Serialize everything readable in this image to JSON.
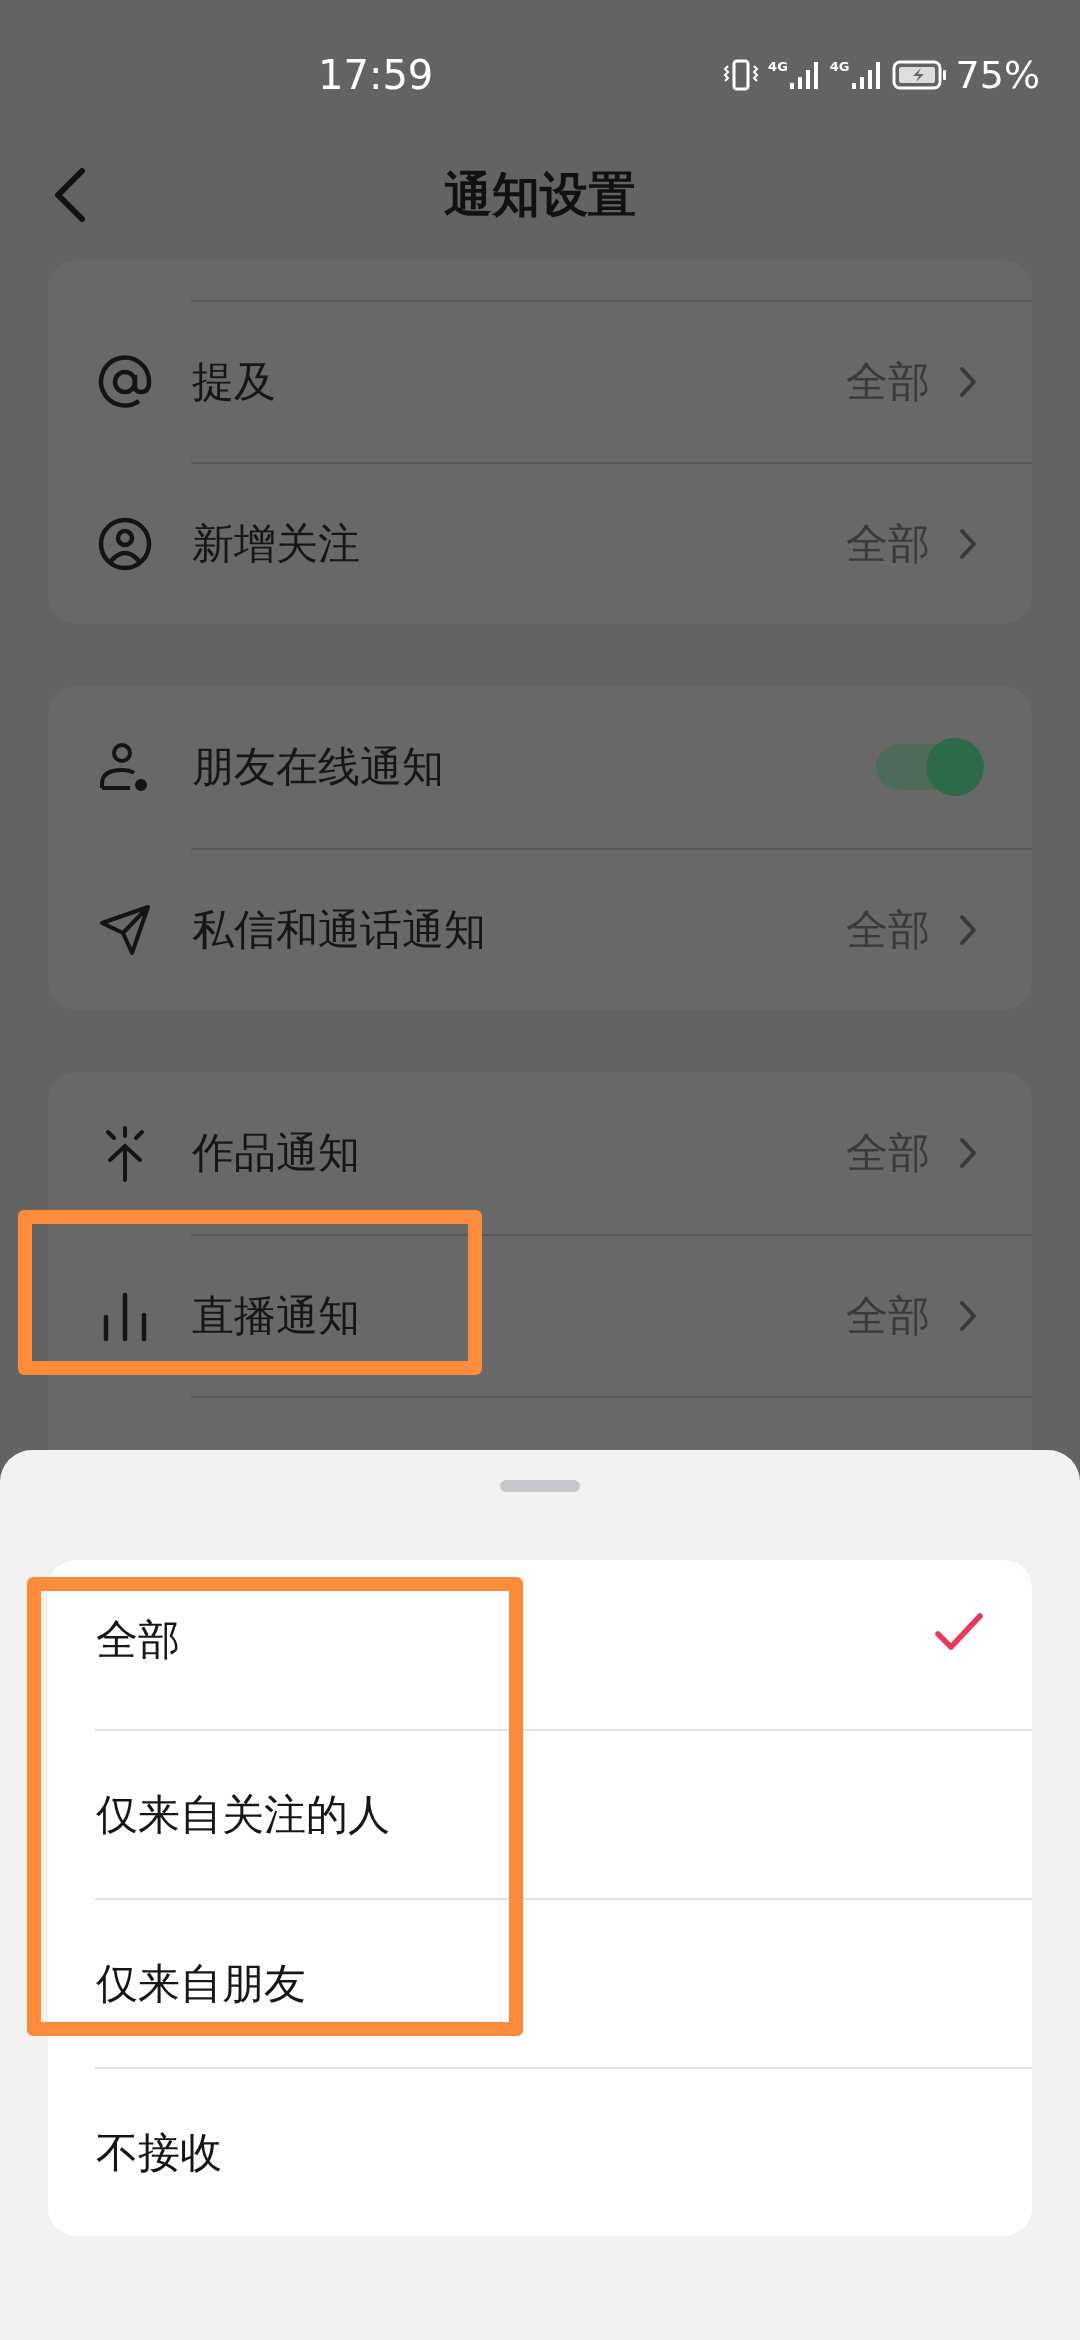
{
  "status_bar": {
    "time": "17:59",
    "networks": [
      "4G",
      "4G"
    ],
    "battery": "75%"
  },
  "header": {
    "title": "通知设置"
  },
  "groups": [
    {
      "items": [
        {
          "kind": "link",
          "label": "提及",
          "value": "全部"
        },
        {
          "kind": "link",
          "label": "新增关注",
          "value": "全部"
        }
      ]
    },
    {
      "items": [
        {
          "kind": "toggle",
          "label": "朋友在线通知",
          "on": true
        },
        {
          "kind": "link",
          "label": "私信和通话通知",
          "value": "全部"
        }
      ]
    },
    {
      "items": [
        {
          "kind": "link",
          "label": "作品通知",
          "value": "全部"
        },
        {
          "kind": "link",
          "label": "直播通知",
          "value": "全部",
          "highlighted": true
        },
        {
          "kind": "hidden"
        }
      ]
    }
  ],
  "sheet": {
    "options": [
      {
        "label": "全部",
        "selected": true,
        "highlighted": true
      },
      {
        "label": "仅来自关注的人",
        "selected": false,
        "highlighted": true
      },
      {
        "label": "仅来自朋友",
        "selected": false,
        "highlighted": true
      },
      {
        "label": "不接收",
        "selected": false,
        "highlighted": false
      }
    ]
  }
}
